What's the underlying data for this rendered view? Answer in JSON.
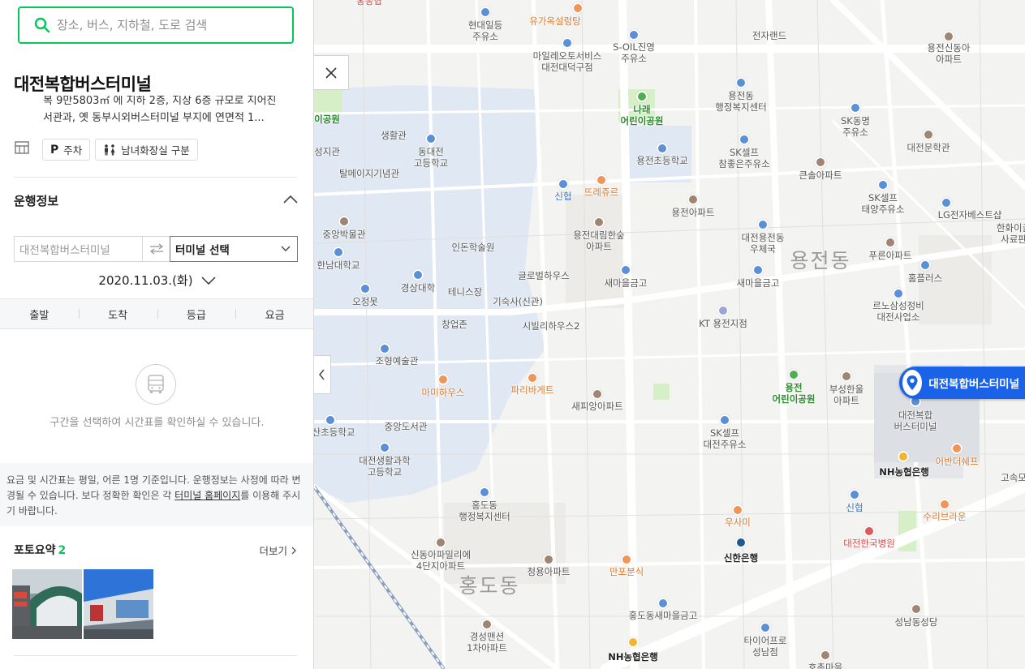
{
  "search": {
    "placeholder": "장소, 버스, 지하철, 도로 검색"
  },
  "place": {
    "title": "대전복합버스터미널",
    "description_line1": "복 9만5803㎡ 에 지하 2층, 지상 6층 규모로 지어진",
    "description_line2": "서관과, 옛 동부시외버스터미널 부지에 연면적 1...",
    "facilities": [
      {
        "icon": "parking-icon",
        "label": "주차"
      },
      {
        "icon": "restroom-icon",
        "label": "남녀화장실 구분"
      }
    ]
  },
  "operation": {
    "title": "운행정보",
    "from_placeholder": "대전복합버스터미널",
    "to_label": "터미널 선택",
    "date": "2020.11.03.(화)",
    "columns": [
      "출발",
      "도착",
      "등급",
      "요금"
    ],
    "empty_message": "구간을 선택하여 시간표를 확인하실 수 있습니다.",
    "notice_part1": "요금 및 시간표는 평일, 어른 1명 기준입니다. 운행정보는 사정에 따라 변경될 수 있습니다. 보다 정확한 확인은 각 ",
    "notice_link": "터미널 홈페이지",
    "notice_part2": "를 이용해 주시기 바랍니다."
  },
  "photos": {
    "title": "포토요약",
    "count": "2",
    "more": "더보기"
  },
  "map": {
    "pin_label": "대전복합버스터미널",
    "areas": [
      "용전동",
      "홍도동"
    ],
    "labels": {
      "l1": "현대일등\n주유소",
      "l2": "유가옥설렁탕",
      "l3": "전자랜드",
      "l4": "용전신동아\n아파트",
      "l5": "마일레오토서비스\n대전대덕구점",
      "l6": "S-OIL진영\n주유소",
      "l7": "나래\n어린이공원",
      "l8": "용전동\n행정복지센터",
      "l9": "SK동명\n주유소",
      "l10": "대전문학관",
      "l11": "생활관",
      "l12": "동대전\n고등학교",
      "l13": "성지관",
      "l14": "탈메이지기념관",
      "l15": "SK셀프\n참좋은주유소",
      "l16": "큰솔아파트",
      "l17": "용전초등학교",
      "l18": "뜨레쥬르",
      "l19": "신협",
      "l20": "용전아파트",
      "l21": "SK셀프\n태양주유소",
      "l22": "LG전자베스트샵",
      "l23": "한화이글\n사료판",
      "l24": "중앙박물관",
      "l25": "용전대림한숲\n아파트",
      "l26": "대전용전동\n우체국",
      "l27": "푸른아파트",
      "l28": "인돈학술원",
      "l29": "한남대학교",
      "l30": "글로벌하우스",
      "l31": "새마을금고",
      "l32": "새마을금고",
      "l33": "홈플러스",
      "l34": "경상대학",
      "l35": "오정못",
      "l36": "테니스장",
      "l37": "기숙사(신관)",
      "l38": "르노삼성정비\n대전사업소",
      "l39": "KT 용전지점",
      "l40": "창업존",
      "l41": "시빌리하우스2",
      "l42": "조형예술관",
      "l43": "마미하우스",
      "l44": "파리바게트",
      "l45": "용전\n어린이공원",
      "l46": "부성한울\n아파트",
      "l47": "새피앙아파트",
      "l48": "대전복합\n버스터미널",
      "l49": "산초등학교",
      "l50": "중앙도서관",
      "l51": "SK셀프\n대전주유소",
      "l52": "어반더쉐프",
      "l53": "대전생활과학\n고등학교",
      "l54": "NH농협은행",
      "l55": "고속모",
      "l56": "홍도동\n행정복지센터",
      "l57": "신협",
      "l58": "수리브라운",
      "l59": "우사미",
      "l60": "대전한국병원",
      "l61": "신동아파밀리에\n4단지아파트",
      "l62": "신한은행",
      "l63": "청용아파트",
      "l64": "만포분식",
      "l65": "홍도동새마을금고",
      "l66": "성남동성당",
      "l67": "경성맨션\n1차아파트",
      "l68": "타이어프로\n성남점",
      "l69": "NH농협은행",
      "l70": "호촌마을",
      "l71": "이공원",
      "l72": "홍농협"
    }
  }
}
